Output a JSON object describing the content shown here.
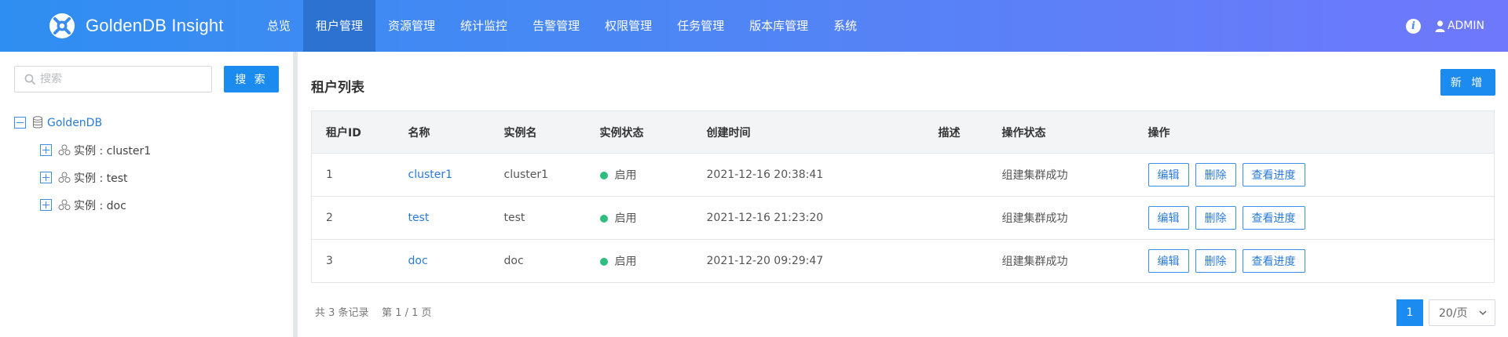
{
  "app": {
    "title": "GoldenDB Insight"
  },
  "nav": {
    "items": [
      "总览",
      "租户管理",
      "资源管理",
      "统计监控",
      "告警管理",
      "权限管理",
      "任务管理",
      "版本库管理",
      "系统"
    ],
    "active": "租户管理"
  },
  "user": {
    "name": "ADMIN"
  },
  "sidebar": {
    "search_placeholder": "搜索",
    "search_button": "搜 索",
    "tree": {
      "root": "GoldenDB",
      "children": [
        "实例 : cluster1",
        "实例 : test",
        "实例 : doc"
      ]
    }
  },
  "main": {
    "title": "租户列表",
    "add_button": "新 增",
    "columns": [
      "租户ID",
      "名称",
      "实例名",
      "实例状态",
      "创建时间",
      "描述",
      "操作状态",
      "操作"
    ],
    "rows": [
      {
        "id": "1",
        "name": "cluster1",
        "instance": "cluster1",
        "status": "启用",
        "created": "2021-12-16 20:38:41",
        "description": "",
        "op_status": "组建集群成功"
      },
      {
        "id": "2",
        "name": "test",
        "instance": "test",
        "status": "启用",
        "created": "2021-12-16 21:23:20",
        "description": "",
        "op_status": "组建集群成功"
      },
      {
        "id": "3",
        "name": "doc",
        "instance": "doc",
        "status": "启用",
        "created": "2021-12-20 09:29:47",
        "description": "",
        "op_status": "组建集群成功"
      }
    ],
    "actions": {
      "edit": "编辑",
      "delete": "删除",
      "progress": "查看进度"
    },
    "summary": "共 3 条记录    第 1 / 1 页",
    "pagination": {
      "current_page": "1",
      "page_size": "20/页"
    }
  },
  "colors": {
    "accent": "#1b8bf0",
    "status_enabled": "#2fbd7f",
    "link": "#2a7ad8"
  }
}
